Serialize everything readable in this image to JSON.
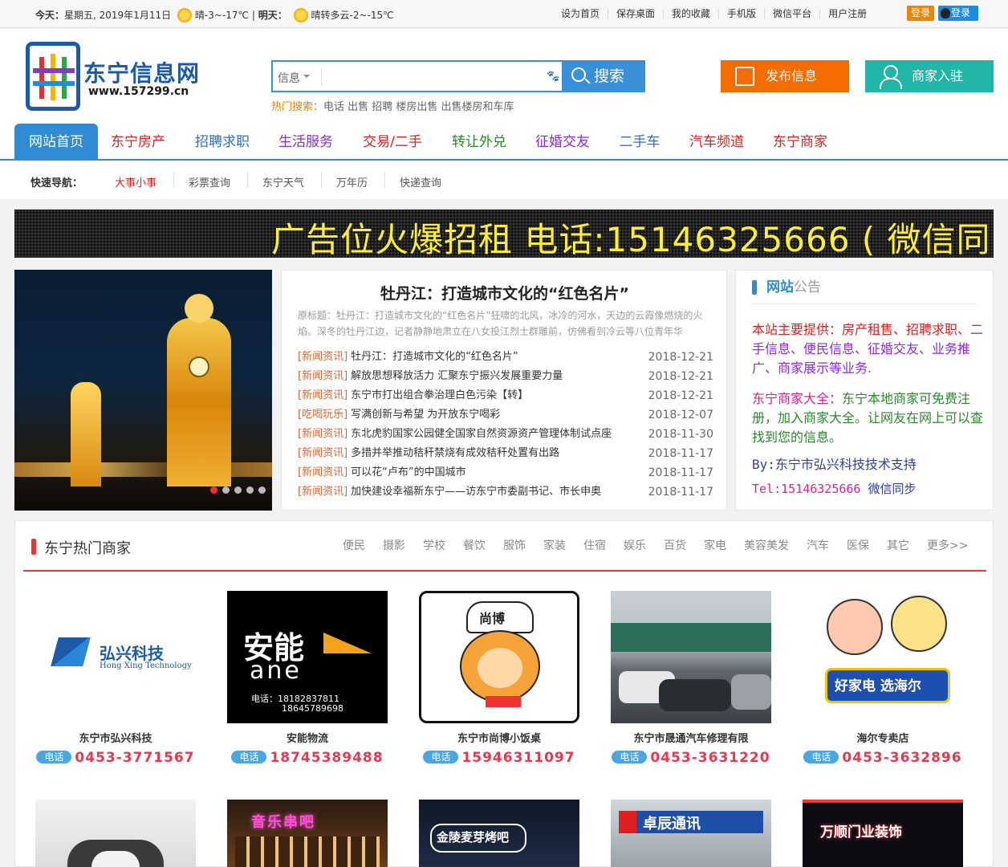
{
  "topbar": {
    "today_label": "今天：",
    "today_date": "星期五, 2019年1月11日",
    "today_weather": "晴-3~-17℃ | ",
    "tomorrow_label": "明天：",
    "tomorrow_weather": "晴转多云-2~-15℃",
    "links": [
      "设为首页",
      "保存桌面",
      "我的收藏",
      "手机版",
      "微信平台",
      "用户注册"
    ],
    "login1": "登录",
    "login2": "登录"
  },
  "header": {
    "logo_title": "东宁信息网",
    "logo_url": "www.157299.cn",
    "search_select": "信息",
    "search_button": "搜索",
    "hot_label": "热门搜索：",
    "hot_terms": "电话 出售 招聘 楼房出售 出售楼房和车库",
    "publish_button": "发布信息",
    "join_button": "商家入驻"
  },
  "nav": [
    "网站首页",
    "东宁房产",
    "招聘求职",
    "生活服务",
    "交易/二手",
    "转让外兑",
    "征婚交友",
    "二手车",
    "汽车频道",
    "东宁商家"
  ],
  "nav_colors": [
    "#ffffff",
    "#e02020",
    "#2f6fd0",
    "#8a2be2",
    "#e02020",
    "#2a8a2a",
    "#8a2be2",
    "#2f6fd0",
    "#e02020",
    "#e02020"
  ],
  "quick": {
    "label": "快速导航：",
    "items": [
      "大事小事",
      "彩票查询",
      "东宁天气",
      "万年历",
      "快递查询"
    ]
  },
  "banner_text": "广告位火爆招租 电话:15146325666 ( 微信同",
  "headline": {
    "title": "牡丹江：打造城市文化的“红色名片”",
    "summary": "原标题：牡丹江：打造城市文化的“红色名片”狂啸的北风，冰冷的河水，天边的云霞像燃烧的火焰。深冬的牡丹江边，记者静静地肃立在八女投江烈士群雕前，仿佛看到冷云等八位青年华"
  },
  "news": [
    {
      "cat": "[新闻资讯]",
      "title": "牡丹江：打造城市文化的“红色名片”",
      "date": "2018-12-21"
    },
    {
      "cat": "[新闻资讯]",
      "title": "解放思想释放活力 汇聚东宁振兴发展重要力量",
      "date": "2018-12-21"
    },
    {
      "cat": "[新闻资讯]",
      "title": "东宁市打出组合拳治理白色污染【转】",
      "date": "2018-12-21"
    },
    {
      "cat": "[吃喝玩乐]",
      "title": "写满创新与希望 为开放东宁喝彩",
      "date": "2018-12-07"
    },
    {
      "cat": "[新闻资讯]",
      "title": "东北虎豹国家公园健全国家自然资源资产管理体制试点座",
      "date": "2018-11-30"
    },
    {
      "cat": "[新闻资讯]",
      "title": "多措并举推动秸秆禁烧有成效秸秆处置有出路",
      "date": "2018-11-17"
    },
    {
      "cat": "[新闻资讯]",
      "title": "可以花“卢布”的中国城市",
      "date": "2018-11-17"
    },
    {
      "cat": "[新闻资讯]",
      "title": "加快建设幸福新东宁——访东宁市委副书记、市长申奥",
      "date": "2018-11-17"
    }
  ],
  "notice": {
    "title_a": "网站",
    "title_b": "公告",
    "p1_red": "本站主要提供：房产租售、招聘求职、",
    "p1_purple": "二手信息、便民信息、征婚交友、业务推广、商家展示等业务.",
    "p2_pink": "东宁商家大全：",
    "p2_green": "东宁本地商家可免费注册，加入商家大全。让网友在网上可以查找到您的信息。",
    "p3_label": "By:",
    "p3_value": "东宁市弘兴科技技术支持",
    "p4_label": "Tel:",
    "p4_value": "15146325666",
    "p4_extra": " 微信同步"
  },
  "biz": {
    "title": "东宁热门商家",
    "cats": [
      "便民",
      "摄影",
      "学校",
      "餐饮",
      "服饰",
      "家装",
      "住宿",
      "娱乐",
      "百货",
      "家电",
      "美容美发",
      "汽车",
      "医保",
      "其它",
      "更多>>"
    ],
    "phone_tag": "电话",
    "cards": [
      {
        "name": "东宁市弘兴科技",
        "phone": "0453-3771567",
        "logo_cn": "弘兴科技",
        "logo_en": "Hong Xing Technology"
      },
      {
        "name": "安能物流",
        "phone": "18745389488",
        "logo_cn": "安能",
        "logo_en": "ane",
        "logo_tel1": "电话：18182837811",
        "logo_tel2": "18645789698"
      },
      {
        "name": "东宁市尚博小饭桌",
        "phone": "15946311097",
        "logo_cn": "尚博"
      },
      {
        "name": "东宁市晟通汽车修理有限",
        "phone": "0453-3631220"
      },
      {
        "name": "海尔专卖店",
        "phone": "0453-3632896",
        "logo_cn": "好家电 选海尔"
      }
    ],
    "row2_signs": [
      "",
      "音乐串吧",
      "金陵麦芽烤吧",
      "卓辰通讯",
      "万顺门业装饰"
    ]
  }
}
